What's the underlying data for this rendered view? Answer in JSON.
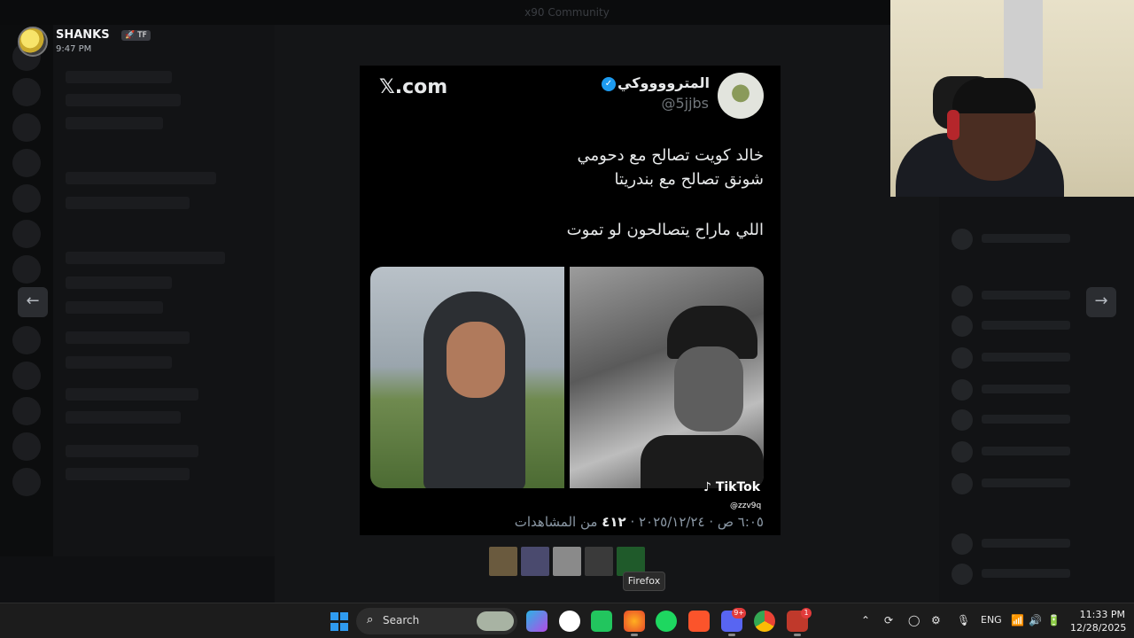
{
  "background": {
    "window_title": "x90 Community"
  },
  "poster": {
    "name": "SHANKS",
    "tag": "TF",
    "time": "9:47 PM"
  },
  "tweet": {
    "site": "𝕏.com",
    "display_name": "المترووووكي",
    "handle": "@5jjbs",
    "line1": "خالد كويت تصالح مع دحومي",
    "line2": "شونق تصالح مع بندريتا",
    "line3": "اللي ماراح يتصالحون لو تموت",
    "meta_time": "٦:٠٥ ص · ٢٠٢٥/١٢/٢٤ ·",
    "views_count": "٤١٢",
    "views_label": "من المشاهدات"
  },
  "media": {
    "watermark": "TikTok",
    "watermark_handle": "@zzv9q"
  },
  "thumbnails": [
    {
      "color": "#6a5a3e"
    },
    {
      "color": "#4a4a6e"
    },
    {
      "color": "#8a8a8a"
    },
    {
      "color": "#3a3a3a"
    },
    {
      "color": "#1f5a2a"
    }
  ],
  "tooltip": "Firefox",
  "taskbar": {
    "search_label": "Search",
    "discord_badge": "9+",
    "app_badge": "1",
    "language": "ENG",
    "time": "11:33 PM",
    "date": "12/28/2025"
  },
  "colors": {
    "accent_blue": "#1d9bf0",
    "discord": "#5865f2",
    "spotify": "#1ed760",
    "brave": "#fb542b"
  }
}
